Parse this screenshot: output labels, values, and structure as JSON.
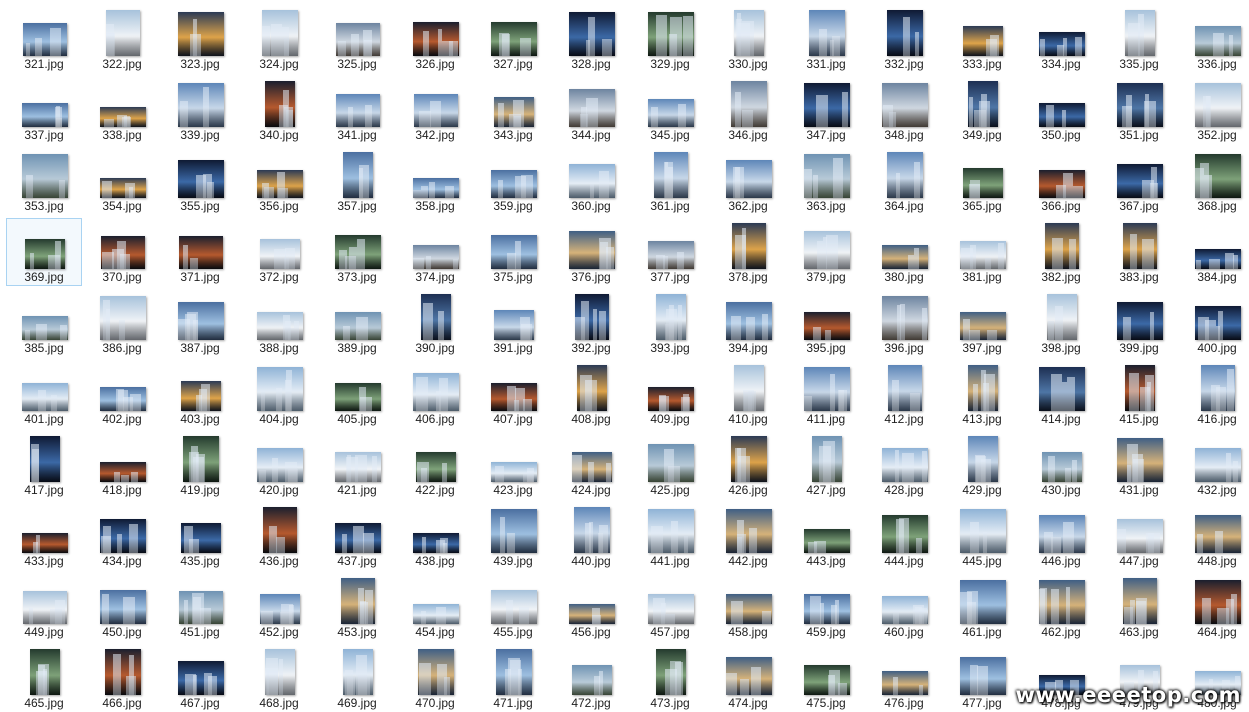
{
  "files": [
    "321.jpg",
    "322.jpg",
    "323.jpg",
    "324.jpg",
    "325.jpg",
    "326.jpg",
    "327.jpg",
    "328.jpg",
    "329.jpg",
    "330.jpg",
    "331.jpg",
    "332.jpg",
    "333.jpg",
    "334.jpg",
    "335.jpg",
    "336.jpg",
    "337.jpg",
    "338.jpg",
    "339.jpg",
    "340.jpg",
    "341.jpg",
    "342.jpg",
    "343.jpg",
    "344.jpg",
    "345.jpg",
    "346.jpg",
    "347.jpg",
    "348.jpg",
    "349.jpg",
    "350.jpg",
    "351.jpg",
    "352.jpg",
    "353.jpg",
    "354.jpg",
    "355.jpg",
    "356.jpg",
    "357.jpg",
    "358.jpg",
    "359.jpg",
    "360.jpg",
    "361.jpg",
    "362.jpg",
    "363.jpg",
    "364.jpg",
    "365.jpg",
    "366.jpg",
    "367.jpg",
    "368.jpg",
    "369.jpg",
    "370.jpg",
    "371.jpg",
    "372.jpg",
    "373.jpg",
    "374.jpg",
    "375.jpg",
    "376.jpg",
    "377.jpg",
    "378.jpg",
    "379.jpg",
    "380.jpg",
    "381.jpg",
    "382.jpg",
    "383.jpg",
    "384.jpg",
    "385.jpg",
    "386.jpg",
    "387.jpg",
    "388.jpg",
    "389.jpg",
    "390.jpg",
    "391.jpg",
    "392.jpg",
    "393.jpg",
    "394.jpg",
    "395.jpg",
    "396.jpg",
    "397.jpg",
    "398.jpg",
    "399.jpg",
    "400.jpg",
    "401.jpg",
    "402.jpg",
    "403.jpg",
    "404.jpg",
    "405.jpg",
    "406.jpg",
    "407.jpg",
    "408.jpg",
    "409.jpg",
    "410.jpg",
    "411.jpg",
    "412.jpg",
    "413.jpg",
    "414.jpg",
    "415.jpg",
    "416.jpg",
    "417.jpg",
    "418.jpg",
    "419.jpg",
    "420.jpg",
    "421.jpg",
    "422.jpg",
    "423.jpg",
    "424.jpg",
    "425.jpg",
    "426.jpg",
    "427.jpg",
    "428.jpg",
    "429.jpg",
    "430.jpg",
    "431.jpg",
    "432.jpg",
    "433.jpg",
    "434.jpg",
    "435.jpg",
    "436.jpg",
    "437.jpg",
    "438.jpg",
    "439.jpg",
    "440.jpg",
    "441.jpg",
    "442.jpg",
    "443.jpg",
    "444.jpg",
    "445.jpg",
    "446.jpg",
    "447.jpg",
    "448.jpg",
    "449.jpg",
    "450.jpg",
    "451.jpg",
    "452.jpg",
    "453.jpg",
    "454.jpg",
    "455.jpg",
    "456.jpg",
    "457.jpg",
    "458.jpg",
    "459.jpg",
    "460.jpg",
    "461.jpg",
    "462.jpg",
    "463.jpg",
    "464.jpg",
    "465.jpg",
    "466.jpg",
    "467.jpg",
    "468.jpg",
    "469.jpg",
    "470.jpg",
    "471.jpg",
    "472.jpg",
    "473.jpg",
    "474.jpg",
    "475.jpg",
    "476.jpg",
    "477.jpg",
    "478.jpg",
    "479.jpg",
    "480.jpg"
  ],
  "selected_file": "369.jpg",
  "watermark": "www.eeeetop.com",
  "colors": {
    "selection_border": "#a9d3f2",
    "selection_fill": "#f3f9fd",
    "label_text": "#1e1e1e"
  }
}
